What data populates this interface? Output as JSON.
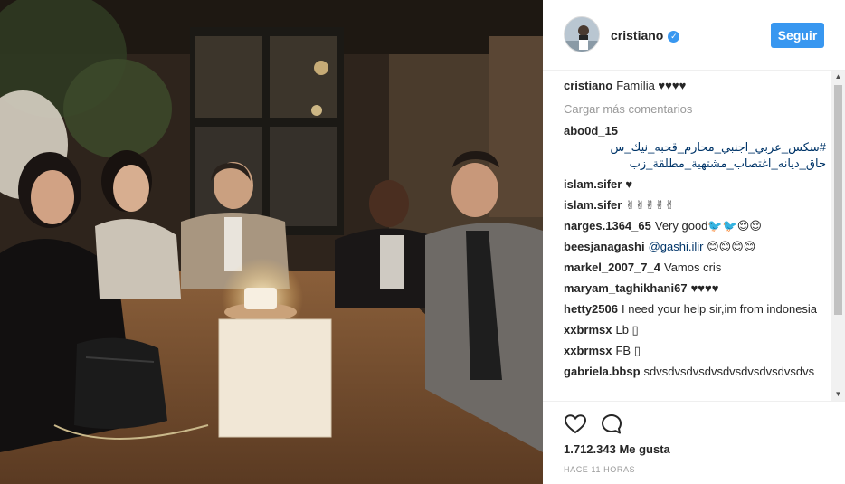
{
  "post": {
    "username": "cristiano",
    "follow_label": "Seguir",
    "likes": "1.712.343 Me gusta",
    "time_ago": "HACE 11 HORAS",
    "load_more": "Cargar más comentarios"
  },
  "caption": {
    "user": "cristiano",
    "text": "Família ♥♥♥♥"
  },
  "comments": [
    {
      "user": "abo0d_15",
      "text": "#سكس_عربي_اجنبي_محارم_قحبه_نيك_س حاق_ديانه_اغتصاب_مشتهية_مطلقة_زب"
    },
    {
      "user": "islam.sifer",
      "text": "♥"
    },
    {
      "user": "islam.sifer",
      "text": "✌✌✌✌✌"
    },
    {
      "user": "narges.1364_65",
      "text": "Very good🐦🐦😌😌"
    },
    {
      "user": "beesjanagashi",
      "mention": "@gashi.ilir",
      "text": "😊😊😊😊"
    },
    {
      "user": "markel_2007_7_4",
      "text": "Vamos cris"
    },
    {
      "user": "maryam_taghikhani67",
      "text": "♥♥♥♥"
    },
    {
      "user": "hetty2506",
      "text": "I need your help sir,im from indonesia"
    },
    {
      "user": "xxbrmsx",
      "text": "Lb ▯"
    },
    {
      "user": "xxbrmsx",
      "text": "FB ▯"
    },
    {
      "user": "gabriela.bbsp",
      "text": "sdvsdvsdvsdvsdvsdvsdvsdvsdvs"
    }
  ],
  "icons": {
    "like": "heart-icon",
    "comment": "comment-bubble-icon",
    "verified": "verified-badge-icon"
  },
  "colors": {
    "accent": "#3897f0",
    "link": "#003569",
    "muted": "#999999"
  }
}
